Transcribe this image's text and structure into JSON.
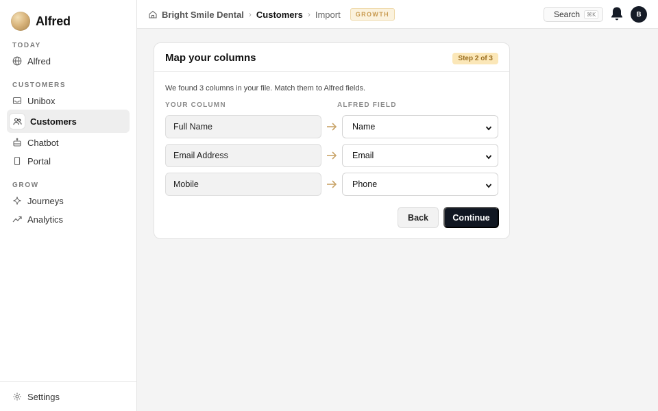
{
  "app": {
    "name": "Alfred"
  },
  "sidebar": {
    "sections": [
      {
        "label": "TODAY"
      },
      {
        "label": "CUSTOMERS"
      },
      {
        "label": "GROW"
      }
    ],
    "items": [
      {
        "label": "Alfred",
        "icon": "globe-icon"
      },
      {
        "label": "Unibox",
        "icon": "inbox-icon"
      },
      {
        "label": "Customers",
        "icon": "users-icon",
        "active": true
      },
      {
        "label": "Chatbot",
        "icon": "chatbot-icon"
      },
      {
        "label": "Portal",
        "icon": "phone-icon"
      },
      {
        "label": "Journeys",
        "icon": "sparkle-icon"
      },
      {
        "label": "Analytics",
        "icon": "trend-icon"
      }
    ],
    "footer": {
      "label": "Settings",
      "icon": "gear-icon"
    }
  },
  "topbar": {
    "breadcrumbs": [
      "Bright Smile Dental",
      "Customers",
      "Import"
    ],
    "plan_badge": "GROWTH",
    "search_label": "Search",
    "search_shortcut": "⌘K",
    "avatar_initial": "B"
  },
  "card": {
    "title": "Map your columns",
    "step": "Step 2 of 3",
    "description": "We found 3 columns in your file. Match them to Alfred fields.",
    "col_source": "YOUR COLUMN",
    "col_target": "ALFRED FIELD",
    "rows": [
      {
        "source": "Full Name",
        "target": "Name"
      },
      {
        "source": "Email Address",
        "target": "Email"
      },
      {
        "source": "Mobile",
        "target": "Phone"
      }
    ],
    "back_label": "Back",
    "continue_label": "Continue"
  },
  "colors": {
    "accent": "#d4a35b",
    "primary": "#111722",
    "badge_bg": "#fbe7b8"
  }
}
